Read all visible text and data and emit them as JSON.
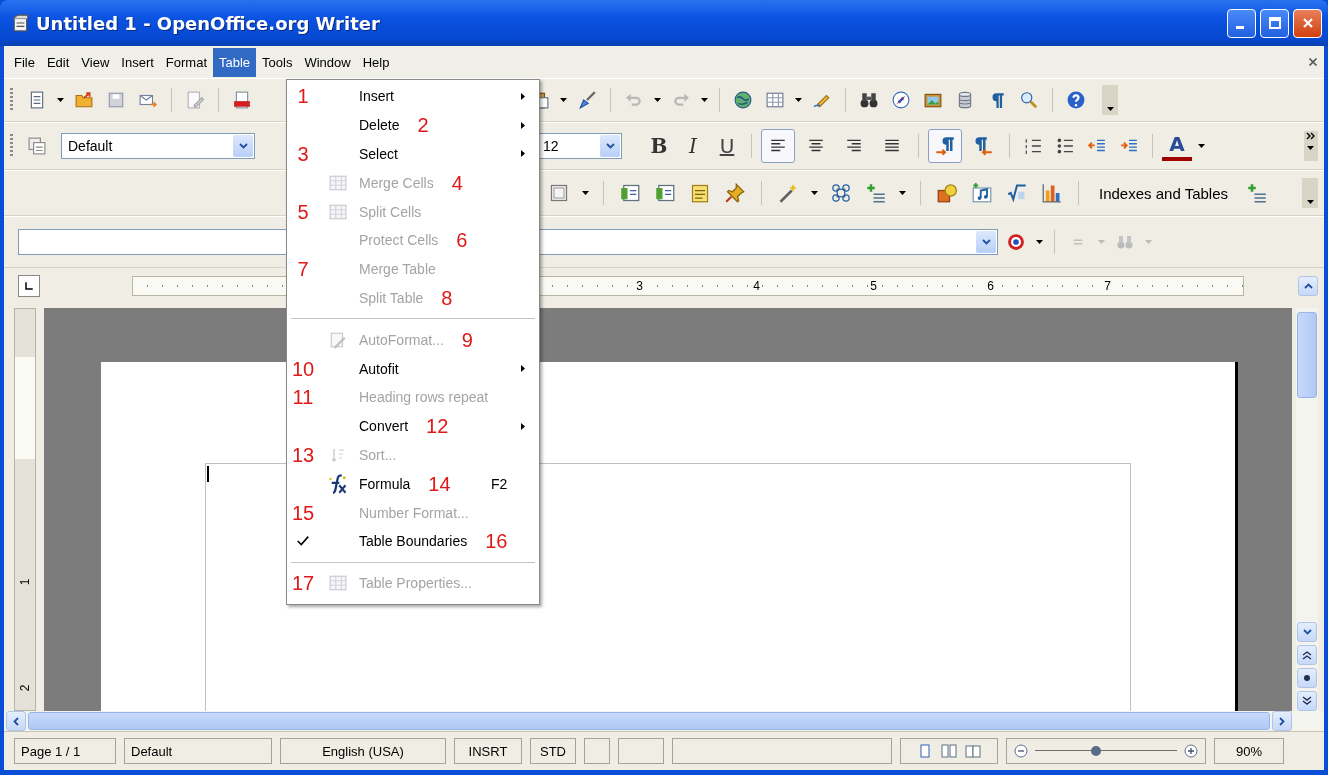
{
  "window": {
    "title": "Untitled 1 - OpenOffice.org Writer"
  },
  "menu_bar": [
    {
      "label": "File",
      "selected": false
    },
    {
      "label": "Edit",
      "selected": false
    },
    {
      "label": "View",
      "selected": false
    },
    {
      "label": "Insert",
      "selected": false
    },
    {
      "label": "Format",
      "selected": false
    },
    {
      "label": "Table",
      "selected": true
    },
    {
      "label": "Tools",
      "selected": false
    },
    {
      "label": "Window",
      "selected": false
    },
    {
      "label": "Help",
      "selected": false
    }
  ],
  "table_menu": {
    "groups": [
      [
        {
          "label": "Insert",
          "kind": "plain",
          "disabled": false,
          "checked": false,
          "submenu": true,
          "note_before": "1"
        },
        {
          "label": "Delete",
          "kind": "plain",
          "disabled": false,
          "checked": false,
          "submenu": true,
          "note_after": "2"
        },
        {
          "label": "Select",
          "kind": "plain",
          "disabled": false,
          "checked": false,
          "submenu": true,
          "note_before": "3"
        },
        {
          "label": "Merge Cells",
          "kind": "grid",
          "disabled": true,
          "checked": false,
          "submenu": false,
          "note_after": "4"
        },
        {
          "label": "Split Cells",
          "kind": "grid",
          "disabled": true,
          "checked": false,
          "submenu": false,
          "note_before": "5"
        },
        {
          "label": "Protect Cells",
          "kind": "plain",
          "disabled": true,
          "checked": false,
          "submenu": false,
          "note_after": "6"
        },
        {
          "label": "Merge Table",
          "kind": "plain",
          "disabled": true,
          "checked": false,
          "submenu": false,
          "note_before": "7"
        },
        {
          "label": "Split Table",
          "kind": "plain",
          "disabled": true,
          "checked": false,
          "submenu": false,
          "note_after": "8"
        }
      ],
      [
        {
          "label": "AutoFormat...",
          "kind": "wand",
          "disabled": true,
          "checked": false,
          "submenu": false,
          "note_after": "9"
        },
        {
          "label": "Autofit",
          "kind": "plain",
          "disabled": false,
          "checked": false,
          "submenu": true,
          "note_before": "10"
        },
        {
          "label": "Heading rows repeat",
          "kind": "plain",
          "disabled": true,
          "checked": false,
          "submenu": false,
          "note_before": "11"
        },
        {
          "label": "Convert",
          "kind": "plain",
          "disabled": false,
          "checked": false,
          "submenu": true,
          "note_after": "12"
        },
        {
          "label": "Sort...",
          "kind": "sort",
          "disabled": true,
          "checked": false,
          "submenu": false,
          "note_before": "13"
        },
        {
          "label": "Formula",
          "kind": "formula",
          "disabled": false,
          "checked": false,
          "submenu": false,
          "note_after": "14",
          "shortcut": "F2"
        },
        {
          "label": "Number Format...",
          "kind": "plain",
          "disabled": true,
          "checked": false,
          "submenu": false,
          "note_before": "15"
        },
        {
          "label": "Table Boundaries",
          "kind": "plain",
          "disabled": false,
          "checked": true,
          "submenu": false,
          "note_after": "16"
        }
      ],
      [
        {
          "label": "Table Properties...",
          "kind": "grid",
          "disabled": true,
          "checked": false,
          "submenu": false,
          "note_before": "17"
        }
      ]
    ]
  },
  "formatting": {
    "paragraph_style": "Default",
    "font_size": "12",
    "format_buttons": [
      "B",
      "I",
      "U"
    ],
    "alignment_buttons": [
      {
        "selected": true
      },
      {
        "selected": false
      },
      {
        "selected": false
      },
      {
        "selected": false
      }
    ],
    "direction_buttons": [
      {
        "selected": true
      },
      {
        "selected": false
      }
    ],
    "font_color": "A"
  },
  "insert_toolbar": {
    "indexes_button": "Indexes and Tables"
  },
  "ruler": {
    "numbers": [
      "3",
      "4",
      "5",
      "6",
      "7"
    ]
  },
  "vertical_ruler": {
    "numbers": [
      "1",
      "2"
    ]
  },
  "status_bar": {
    "page": "Page 1 / 1",
    "style": "Default",
    "language": "English (USA)",
    "insert_mode": "INSRT",
    "selection_mode": "STD",
    "zoom_slider": {
      "level": 0.43
    },
    "zoom": "90%"
  }
}
